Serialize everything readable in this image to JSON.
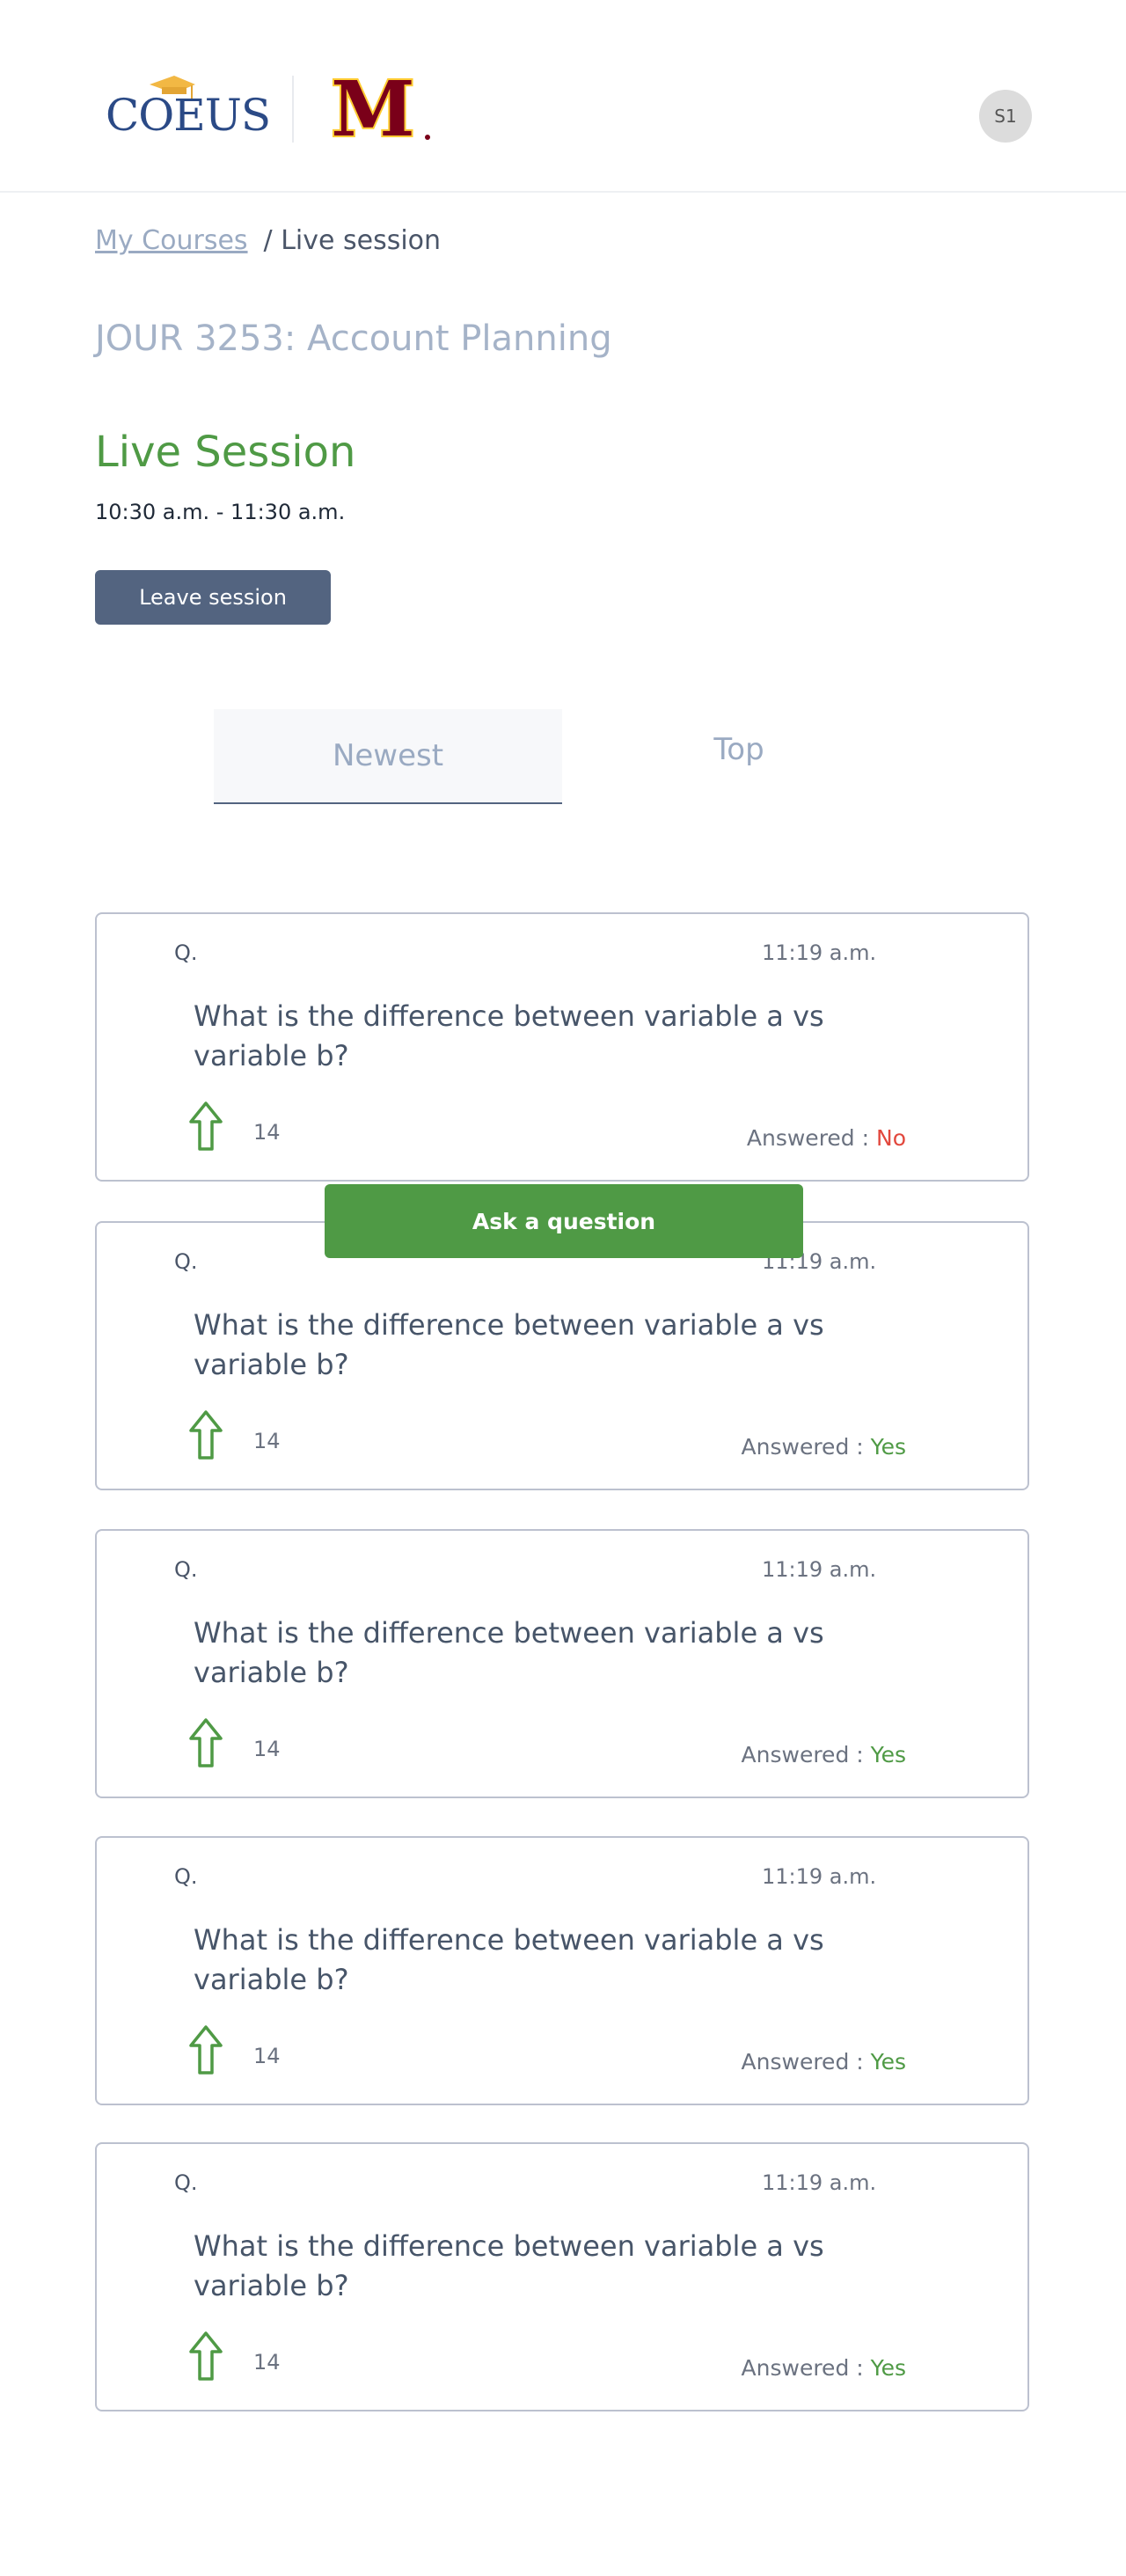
{
  "header": {
    "logo_text": "COEUS",
    "university_logo_text": "M",
    "avatar_initials": "S1"
  },
  "breadcrumb": {
    "link": "My Courses",
    "current": "/ Live session"
  },
  "course_title": "JOUR 3253: Account Planning",
  "session": {
    "title": "Live Session",
    "time": "10:30 a.m. - 11:30 a.m.",
    "leave_label": "Leave session"
  },
  "tabs": [
    {
      "label": "Newest",
      "active": true
    },
    {
      "label": "Top",
      "active": false
    }
  ],
  "ask_label": "Ask a question",
  "questions": [
    {
      "label": "Q.",
      "time": "11:19 a.m.",
      "text": "What is the difference between variable a vs variable b?",
      "votes": "14",
      "answered_label": "Answered : ",
      "answered": "No"
    },
    {
      "label": "Q.",
      "time": "11:19 a.m.",
      "text": "What is the difference between variable a vs variable b?",
      "votes": "14",
      "answered_label": "Answered : ",
      "answered": "Yes"
    },
    {
      "label": "Q.",
      "time": "11:19 a.m.",
      "text": "What is the difference between variable a vs variable b?",
      "votes": "14",
      "answered_label": "Answered : ",
      "answered": "Yes"
    },
    {
      "label": "Q.",
      "time": "11:19 a.m.",
      "text": "What is the difference between variable a vs variable b?",
      "votes": "14",
      "answered_label": "Answered : ",
      "answered": "Yes"
    },
    {
      "label": "Q.",
      "time": "11:19 a.m.",
      "text": "What is the difference between variable a vs variable b?",
      "votes": "14",
      "answered_label": "Answered : ",
      "answered": "Yes"
    }
  ],
  "colors": {
    "accent_green": "#4f9a45",
    "slate": "#536480",
    "muted_blue": "#9aaac2",
    "no_red": "#e2483d",
    "umn_maroon": "#7a0019",
    "umn_gold": "#ffcc33"
  }
}
